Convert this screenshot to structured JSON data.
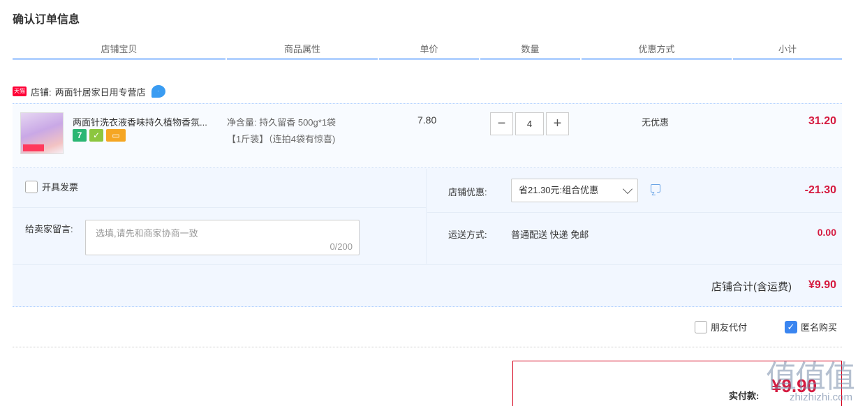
{
  "page_title": "确认订单信息",
  "columns": [
    "店铺宝贝",
    "商品属性",
    "单价",
    "数量",
    "优惠方式",
    "小计"
  ],
  "shop": {
    "badge": "天猫",
    "label": "店铺:",
    "name": "两面针居家日用专营店"
  },
  "item": {
    "title": "两面针洗衣液香味持久植物香氛...",
    "attr_line1": "净含量: 持久留香 500g*1袋",
    "attr_line2": "【1斤装】（连拍4袋有惊喜)",
    "unit_price": "7.80",
    "quantity": "4",
    "qty_minus": "−",
    "qty_plus": "+",
    "discount": "无优惠",
    "subtotal": "31.20",
    "service_icons": [
      "7",
      "✓",
      "▭"
    ]
  },
  "invoice": {
    "label": "开具发票",
    "checked": false
  },
  "message": {
    "label": "给卖家留言:",
    "placeholder": "选填,请先和商家协商一致",
    "count": "0/200"
  },
  "shop_discount": {
    "label": "店铺优惠:",
    "selected": "省21.30元:组合优惠",
    "amount": "-21.30"
  },
  "shipping": {
    "label": "运送方式:",
    "value": "普通配送 快递 免邮",
    "amount": "0.00"
  },
  "shop_total": {
    "label": "店铺合计(含运费)",
    "value": "¥9.90"
  },
  "friend_pay": {
    "label": "朋友代付",
    "checked": false
  },
  "anonymous": {
    "label": "匿名购买",
    "checked": true
  },
  "payment": {
    "label": "实付款:",
    "value": "¥9.90"
  },
  "watermark": {
    "glyphs": "值值值",
    "url": "zhizhizhi.com"
  },
  "colors": {
    "accent_red": "#d51a3f",
    "header_underline": "#b2d1ff",
    "panel_bg": "#f2f7ff",
    "checkbox_blue": "#3a85f0"
  }
}
